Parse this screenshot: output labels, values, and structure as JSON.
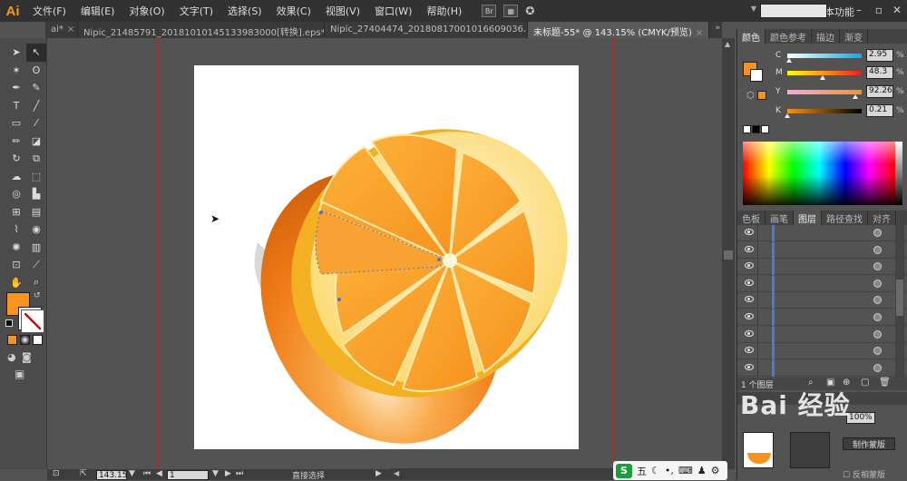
{
  "app": {
    "logo": "Ai",
    "workspace": "基本功能"
  },
  "menu": [
    "文件(F)",
    "编辑(E)",
    "对象(O)",
    "文字(T)",
    "选择(S)",
    "效果(C)",
    "视图(V)",
    "窗口(W)",
    "帮助(H)"
  ],
  "menu_box": "Br",
  "tabs": [
    {
      "label": "ai*",
      "active": false
    },
    {
      "label": "Nipic_21485791_20181010145133983000[转换].eps*",
      "active": false
    },
    {
      "label": "Nipic_27404474_20180817001016609036.ai*",
      "active": false
    },
    {
      "label": "未标题-55* @ 143.15% (CMYK/预览)",
      "active": true
    }
  ],
  "color_panel": {
    "tabs": [
      "颜色",
      "颜色参考",
      "描边",
      "渐变"
    ],
    "channels": [
      {
        "letter": "C",
        "value": "2.95",
        "fraction": 0.03,
        "gradient": "linear-gradient(to right,#fff,#00aeef)"
      },
      {
        "letter": "M",
        "value": "48.3",
        "fraction": 0.48,
        "gradient": "linear-gradient(to right,#ff0,#f7931e,#ed1c24)"
      },
      {
        "letter": "Y",
        "value": "92.26",
        "fraction": 0.92,
        "gradient": "linear-gradient(to right,#f7a8e0,#f7931e)"
      },
      {
        "letter": "K",
        "value": "0.21",
        "fraction": 0.0,
        "gradient": "linear-gradient(to right,#f7931e,#000)"
      }
    ],
    "pct": "%",
    "fill_color": "#f7931e"
  },
  "layers_panel": {
    "tabs": [
      "色板",
      "画笔",
      "图层",
      "路径查找",
      "对齐"
    ],
    "footer_label": "1 个图层"
  },
  "transparency": {
    "opacity": "100%",
    "make_mask": "制作蒙版",
    "invert_mask": "反相蒙版"
  },
  "status": {
    "zoom": "143.15",
    "page": "1",
    "tool": "直接选择"
  },
  "watermark": "Bai 经验",
  "ime": {
    "logo": "S",
    "mode": "五"
  },
  "colors": {
    "orange": "#f7931e",
    "menubar": "#323232",
    "panel": "#535353"
  }
}
